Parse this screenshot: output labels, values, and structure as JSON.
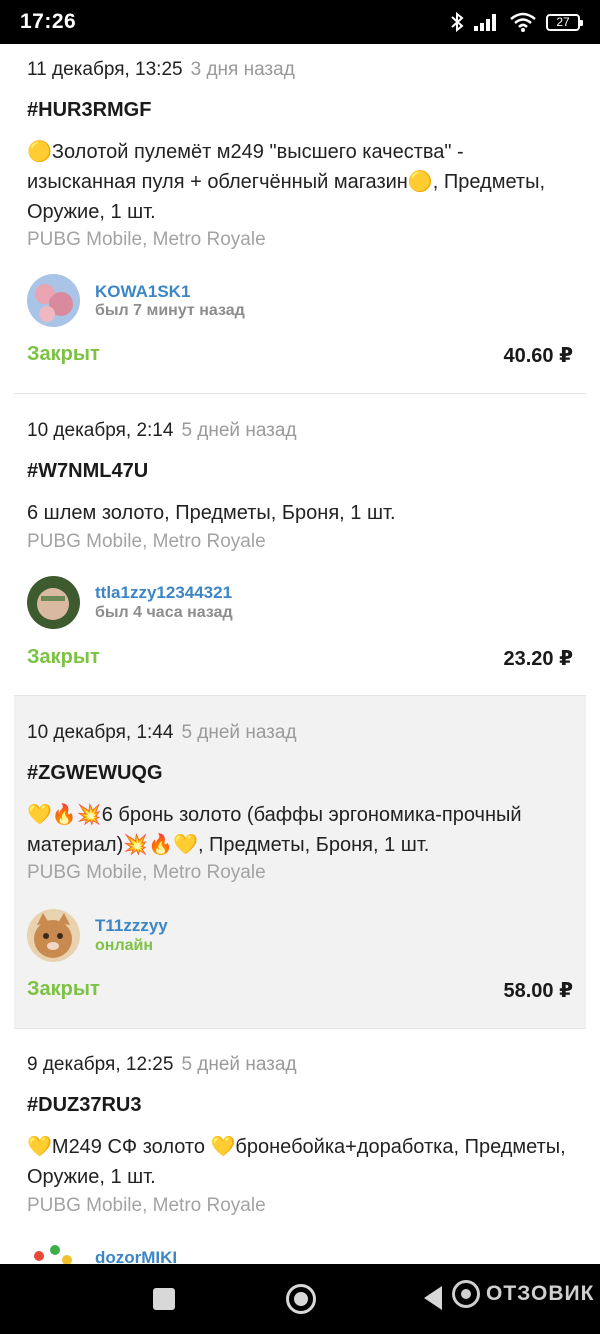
{
  "status_bar": {
    "time": "17:26",
    "battery": "27"
  },
  "orders": [
    {
      "date": "11 декабря, 13:25",
      "ago": "3 дня назад",
      "id": "#HUR3RMGF",
      "description": "🟡Золотой пулемёт м249 \"высшего качества\" - изысканная пуля + облегчённый магазин🟡, Предметы, Оружие, 1 шт.",
      "game": "PUBG Mobile, Metro Royale",
      "user": "KOWA1SK1",
      "seen": "был 7 минут назад",
      "status": "Закрыт",
      "price": "40.60 ₽"
    },
    {
      "date": "10 декабря, 2:14",
      "ago": "5 дней назад",
      "id": "#W7NML47U",
      "description": "6 шлем золото, Предметы, Броня, 1 шт.",
      "game": "PUBG Mobile, Metro Royale",
      "user": "ttla1zzy12344321",
      "seen": "был 4 часа назад",
      "status": "Закрыт",
      "price": "23.20 ₽"
    },
    {
      "date": "10 декабря, 1:44",
      "ago": "5 дней назад",
      "id": "#ZGWEWUQG",
      "description": "💛🔥💥6 бронь золото (баффы эргономика-прочный материал)💥🔥💛, Предметы, Броня, 1 шт.",
      "game": "PUBG Mobile, Metro Royale",
      "user": "T11zzzyy",
      "seen": "онлайн",
      "status": "Закрыт",
      "price": "58.00 ₽"
    },
    {
      "date": "9 декабря, 12:25",
      "ago": "5 дней назад",
      "id": "#DUZ37RU3",
      "description": "💛М249 СФ золото 💛бронебойка+доработка, Предметы, Оружие, 1 шт.",
      "game": "PUBG Mobile, Metro Royale",
      "user": "dozorMIKI"
    }
  ],
  "watermark": "ОТЗОВИК",
  "colors": {
    "accent_green": "#7cc243",
    "link_blue": "#3d86c6",
    "muted": "#a3a3a3"
  }
}
